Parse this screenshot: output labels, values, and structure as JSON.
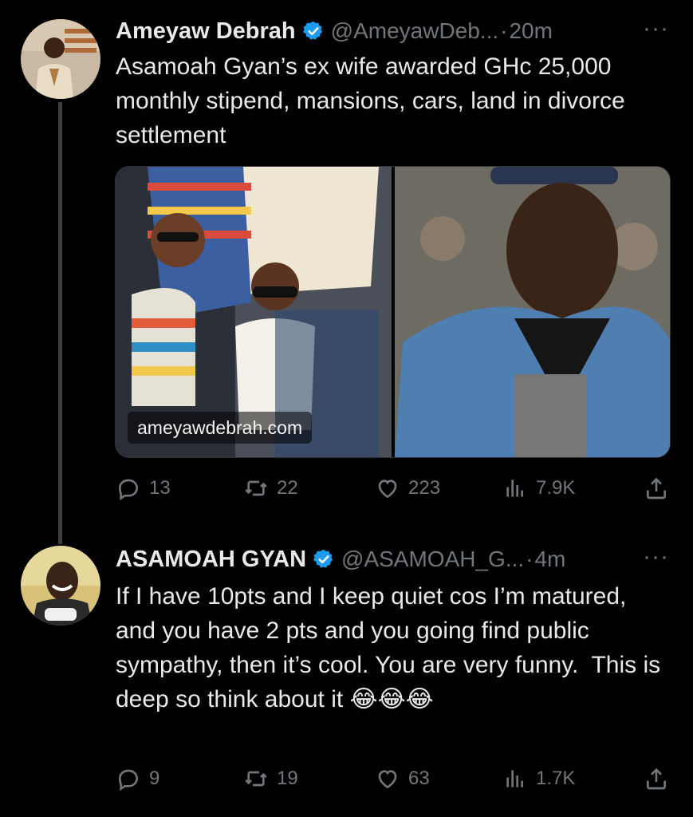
{
  "tweets": [
    {
      "name": "Ameyaw Debrah",
      "handle": "@AmeyawDeb...",
      "dot": "·",
      "time": "20m",
      "text": "Asamoah Gyan’s ex wife awarded GHc 25,000 monthly stipend, mansions, cars, land in divorce settlement",
      "media_watermark": "ameyawdebrah.com",
      "stats": {
        "replies": "13",
        "reposts": "22",
        "likes": "223",
        "views": "7.9K"
      }
    },
    {
      "name": "ASAMOAH GYAN",
      "handle": "@ASAMOAH_G...",
      "dot": "·",
      "time": "4m",
      "text": "If I have 10pts and I keep quiet cos I’m matured, and you have 2 pts and you going find public sympathy, then it’s cool. You are very funny.  This is deep so think about it 😂😂😂",
      "stats": {
        "replies": "9",
        "reposts": "19",
        "likes": "63",
        "views": "1.7K"
      }
    }
  ],
  "more_glyph": "···",
  "colors": {
    "background": "#000000",
    "text": "#e7e9ea",
    "muted": "#71767b",
    "verified": "#1d9bf0",
    "thread_line": "#3b3f44"
  }
}
